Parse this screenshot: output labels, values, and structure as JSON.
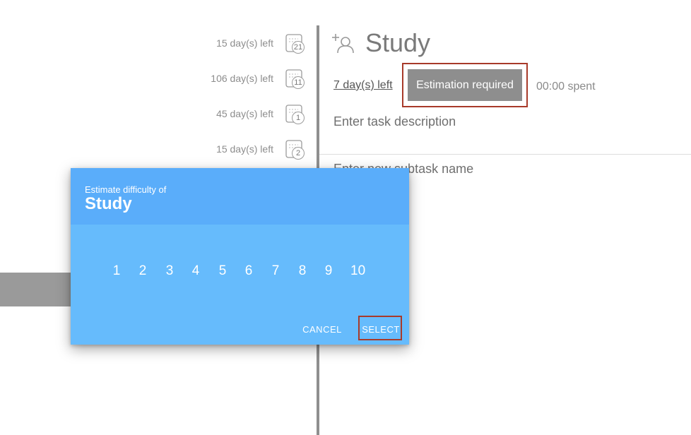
{
  "tasks": [
    {
      "days_left": "15 day(s) left",
      "count": "21"
    },
    {
      "days_left": "106 day(s) left",
      "count": "11"
    },
    {
      "days_left": "45 day(s) left",
      "count": "1"
    },
    {
      "days_left": "15 day(s) left",
      "count": "2"
    }
  ],
  "task_panel": {
    "title": "Study",
    "days_left_link": "7 day(s) left",
    "estimation_button": "Estimation required",
    "time_spent": "00:00 spent",
    "description_placeholder": "Enter task description",
    "subtask_placeholder": "Enter new subtask name"
  },
  "modal": {
    "subtitle": "Estimate difficulty of",
    "title": "Study",
    "options": [
      "1",
      "2",
      "3",
      "4",
      "5",
      "6",
      "7",
      "8",
      "9",
      "10"
    ],
    "cancel_label": "CANCEL",
    "select_label": "SELECT"
  },
  "colors": {
    "modal_body": "#66bbfc",
    "modal_header": "#5aadfa",
    "estimation_button": "#8e8e8e",
    "highlight_outline": "#a83a2a",
    "divider": "#8f8f8f"
  },
  "icons": {
    "task_calendar": "calendar-icon",
    "assign_user": "add-user-icon"
  }
}
